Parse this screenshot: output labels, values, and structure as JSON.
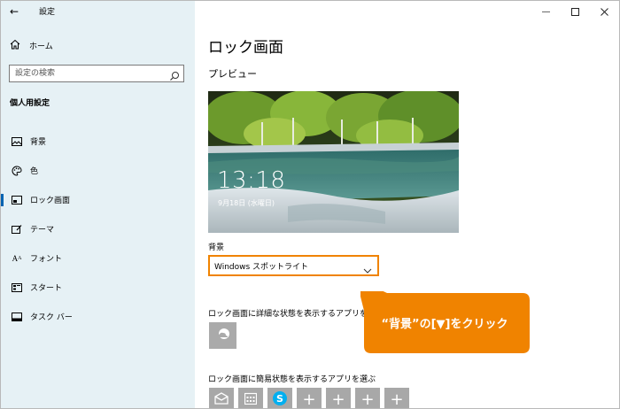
{
  "app": {
    "title": "設定"
  },
  "sidebar": {
    "home_label": "ホーム",
    "search_placeholder": "設定の検索",
    "section_title": "個人用設定",
    "items": [
      {
        "label": "背景",
        "icon": "picture-icon"
      },
      {
        "label": "色",
        "icon": "palette-icon"
      },
      {
        "label": "ロック画面",
        "icon": "lock-screen-icon",
        "active": true
      },
      {
        "label": "テーマ",
        "icon": "theme-icon"
      },
      {
        "label": "フォント",
        "icon": "font-icon"
      },
      {
        "label": "スタート",
        "icon": "start-icon"
      },
      {
        "label": "タスク バー",
        "icon": "taskbar-icon"
      }
    ]
  },
  "main": {
    "title": "ロック画面",
    "preview_label": "プレビュー",
    "preview_time": "13:18",
    "preview_date": "9月18日 (水曜日)",
    "background_label": "背景",
    "background_value": "Windows スポットライト",
    "detail_label": "ロック画面に詳細な状態を表示するアプリを 1",
    "quick_label": "ロック画面に簡易状態を表示するアプリを選ぶ",
    "quick_tiles": [
      "mail-icon",
      "calendar-icon",
      "skype-icon",
      "+",
      "+",
      "+",
      "+"
    ]
  },
  "callout": {
    "text": "“背景”の[▼]をクリック",
    "color": "#f08300"
  },
  "colors": {
    "sidebar_bg": "#e6f1f5",
    "accent": "#0063b1",
    "highlight": "#f08300"
  }
}
